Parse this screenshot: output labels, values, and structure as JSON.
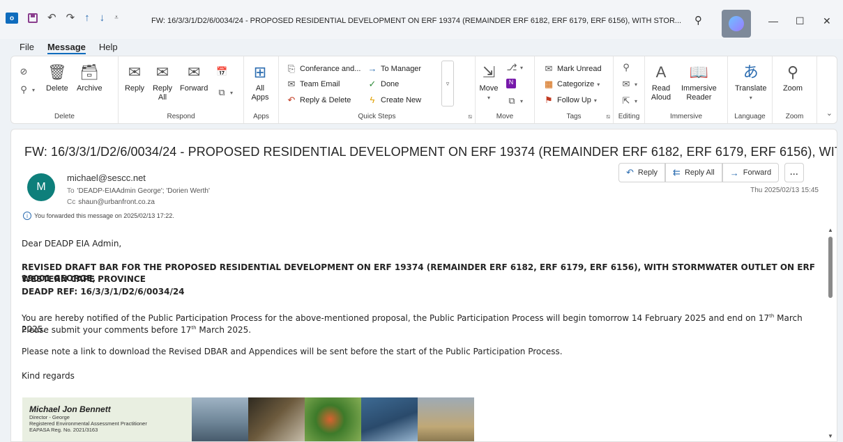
{
  "window": {
    "title": "FW: 16/3/3/1/D2/6/0034/24 - PROPOSED RESIDENTIAL DEVELOPMENT ON ERF 19374 (REMAINDER ERF 6182, ERF 6179, ERF 6156), WITH STOR...",
    "icons": [
      "outlook-icon",
      "save-icon",
      "undo-icon",
      "redo-icon",
      "up-icon",
      "down-icon",
      "customize-icon",
      "search-icon",
      "copilot-icon",
      "minimize-icon",
      "maximize-icon",
      "close-icon"
    ]
  },
  "menu": [
    "File",
    "Message",
    "Help"
  ],
  "ribbon": {
    "delete_group": {
      "label": "Delete",
      "delete": "Delete",
      "archive": "Archive"
    },
    "respond_group": {
      "label": "Respond",
      "reply": "Reply",
      "reply_all_1": "Reply",
      "reply_all_2": "All",
      "forward": "Forward"
    },
    "apps_group": {
      "label": "Apps",
      "all_apps_1": "All",
      "all_apps_2": "Apps"
    },
    "quick_steps": {
      "label": "Quick Steps",
      "items": [
        "Conferance and...",
        "To Manager",
        "Team Email",
        "Done",
        "Reply & Delete",
        "Create New"
      ]
    },
    "move_group": {
      "label": "Move",
      "move": "Move"
    },
    "tags_group": {
      "label": "Tags",
      "mark_unread": "Mark Unread",
      "categorize": "Categorize",
      "follow_up": "Follow Up"
    },
    "editing_group": {
      "label": "Editing"
    },
    "immersive_group": {
      "label": "Immersive",
      "read_aloud_1": "Read",
      "read_aloud_2": "Aloud",
      "reader_1": "Immersive",
      "reader_2": "Reader"
    },
    "language_group": {
      "label": "Language",
      "translate": "Translate"
    },
    "zoom_group": {
      "label": "Zoom",
      "zoom": "Zoom"
    }
  },
  "message": {
    "subject": "FW: 16/3/3/1/D2/6/0034/24 - PROPOSED RESIDENTIAL DEVELOPMENT ON ERF 19374 (REMAINDER ERF 6182, ERF 6179, ERF 6156), WITH STO...",
    "avatar_initial": "M",
    "from": "michael@sescc.net",
    "to_label": "To",
    "to": "'DEADP-EIAAdmin George'; 'Dorien Werth'",
    "cc_label": "Cc",
    "cc": "shaun@urbanfront.co.za",
    "forward_note": "You forwarded this message on 2025/02/13 17:22.",
    "date": "Thu 2025/02/13 15:45",
    "actions": {
      "reply": "Reply",
      "reply_all": "Reply All",
      "forward": "Forward",
      "more": "..."
    }
  },
  "body": {
    "greeting": "Dear DEADP EIA Admin,",
    "heading_1": "REVISED DRAFT BAR FOR THE PROPOSED RESIDENTIAL DEVELOPMENT ON ERF 19374 (REMAINDER ERF 6182, ERF 6179, ERF 6156), WITH STORMWATER OUTLET ON ERF 19001 GEORGE,",
    "heading_2": "WESTERN CAPE PROVINCE",
    "heading_3": "DEADP REF: 16/3/3/1/D2/6/0034/24",
    "para1_a": "You are hereby notified of the Public Participation Process for the above-mentioned proposal, the Public Participation Process will begin tomorrow 14 February 2025 and end on 17",
    "para1_sup": "th",
    "para1_b": " March 2025.",
    "para2_a": "Please submit your comments before 17",
    "para2_sup": "th",
    "para2_b": " March 2025.",
    "para3": "Please note a link to download the Revised DBAR and Appendices will be sent before the start of the Public Participation Process.",
    "closing": "Kind regards"
  },
  "signature": {
    "name": "Michael Jon Bennett",
    "line1": "Director - George",
    "line2": "Registered Environmental Assessment Practitioner",
    "line3": "EAPASA Reg. No. 2021/3163"
  }
}
